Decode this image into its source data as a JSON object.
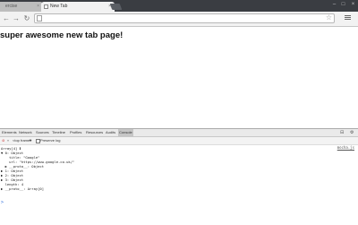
{
  "tabs": [
    {
      "title": "ercise",
      "active": false
    },
    {
      "title": "New Tab",
      "active": true
    }
  ],
  "window_controls": [
    "–",
    "□",
    "×"
  ],
  "toolbar": {
    "omnibox_value": "",
    "back": "←",
    "forward": "→",
    "reload": "↻"
  },
  "page": {
    "heading": "super awesome new tab page!"
  },
  "devtools": {
    "tabs": [
      "Elements",
      "Network",
      "Sources",
      "Timeline",
      "Profiles",
      "Resources",
      "Audits",
      "Console"
    ],
    "selected_tab": "Console",
    "frame_select": "<top frame>",
    "preserve_log": "Preserve log",
    "source_link": "mocha.js",
    "console_lines": [
      "Array[4] ℹ",
      "▼ 0: Object",
      "    title: \"Google\"",
      "    url: \"https://www.google.co.uk/\"",
      "  ▶ __proto__: Object",
      "▶ 1: Object",
      "▶ 2: Object",
      "▶ 3: Object",
      "  length: 4",
      "▶ __proto__: Array[0]"
    ],
    "prompt": ">"
  },
  "colors": {
    "tabstrip_bg": "#3a3d42",
    "toolbar_bg": "#f2f2f2",
    "console_string": "#c41a16"
  }
}
